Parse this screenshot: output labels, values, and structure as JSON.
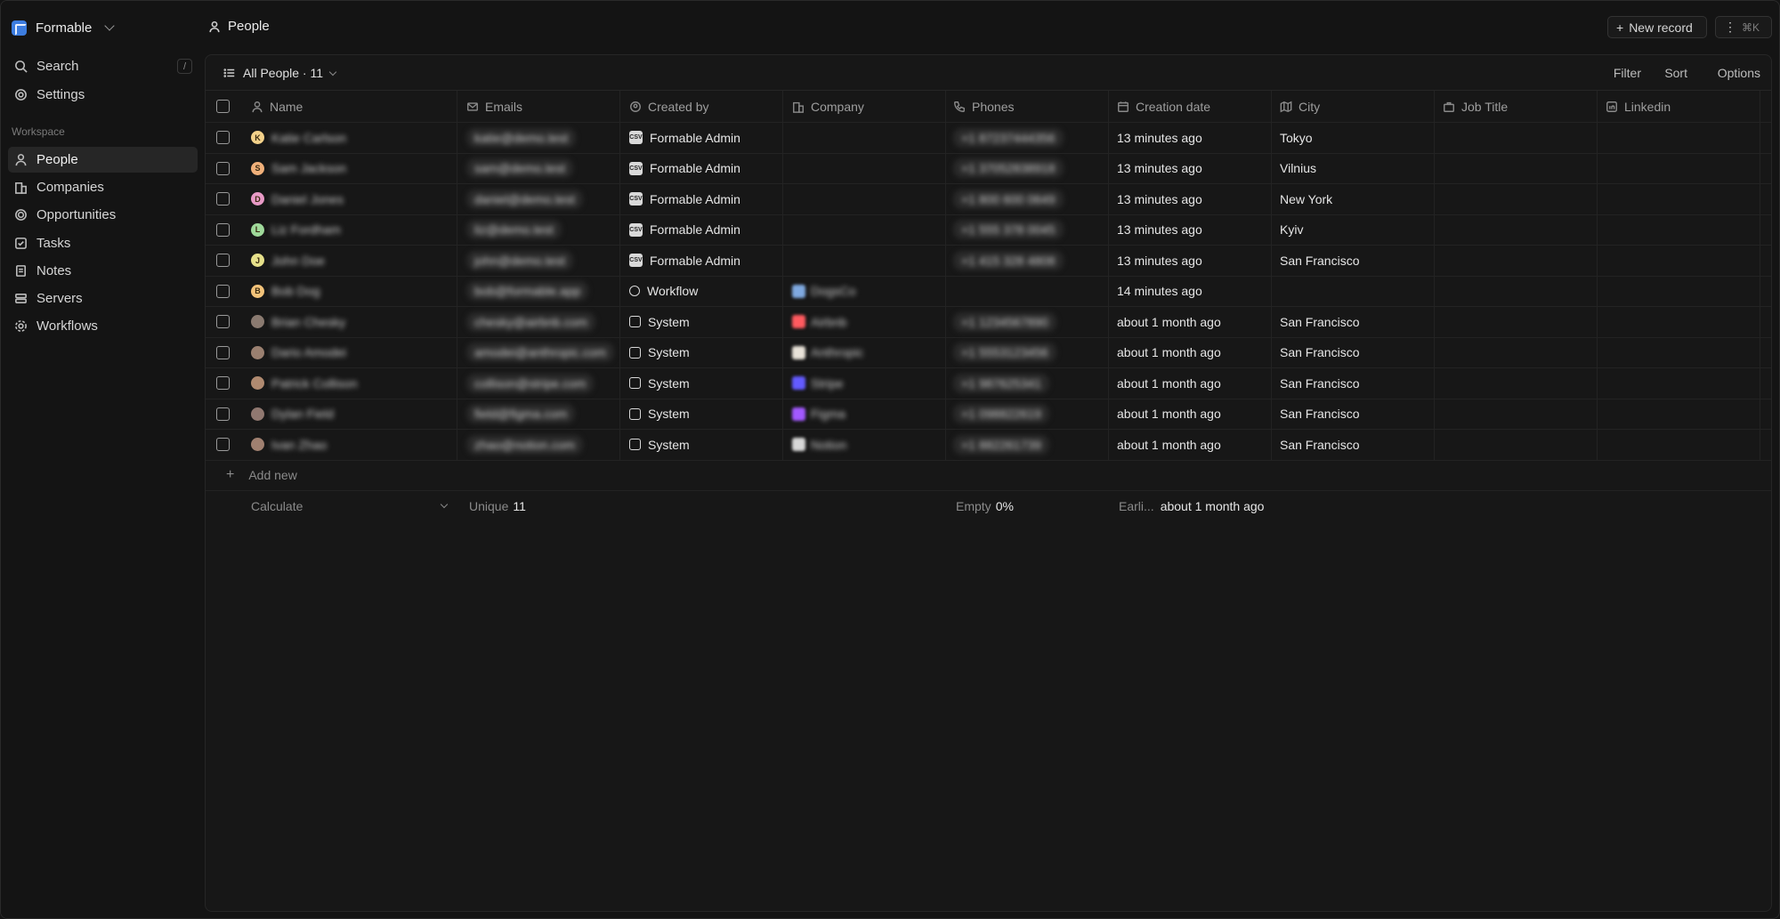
{
  "workspace": {
    "name": "Formable"
  },
  "sidebar": {
    "top_items": [
      {
        "label": "Search",
        "icon": "search-icon",
        "shortcut": "/"
      },
      {
        "label": "Settings",
        "icon": "gear-icon"
      }
    ],
    "section_label": "Workspace",
    "items": [
      {
        "label": "People",
        "icon": "person-icon",
        "active": true
      },
      {
        "label": "Companies",
        "icon": "building-icon"
      },
      {
        "label": "Opportunities",
        "icon": "target-icon"
      },
      {
        "label": "Tasks",
        "icon": "checkbox-icon"
      },
      {
        "label": "Notes",
        "icon": "note-icon"
      },
      {
        "label": "Servers",
        "icon": "server-icon"
      },
      {
        "label": "Workflows",
        "icon": "workflow-icon"
      }
    ]
  },
  "header": {
    "title": "People",
    "new_record_label": "New record",
    "more_shortcut": "⌘K"
  },
  "view": {
    "name": "All People · 11",
    "actions": {
      "filter": "Filter",
      "sort": "Sort",
      "options": "Options"
    }
  },
  "table": {
    "columns": [
      "Name",
      "Emails",
      "Created by",
      "Company",
      "Phones",
      "Creation date",
      "City",
      "Job Title",
      "Linkedin"
    ],
    "rows": [
      {
        "initial": "K",
        "avatar_color": "#f3d18a",
        "name": "Katie Carlson",
        "email": "katie@demo.test",
        "created_by": "Formable Admin",
        "creator_type": "csv",
        "company": "",
        "company_color": "",
        "phone": "+1 87237444356",
        "date": "13 minutes ago",
        "city": "Tokyo"
      },
      {
        "initial": "S",
        "avatar_color": "#f0b07a",
        "name": "Sam Jackson",
        "email": "sam@demo.test",
        "created_by": "Formable Admin",
        "creator_type": "csv",
        "company": "",
        "company_color": "",
        "phone": "+1 37052838918",
        "date": "13 minutes ago",
        "city": "Vilnius"
      },
      {
        "initial": "D",
        "avatar_color": "#e89ac6",
        "name": "Daniel Jones",
        "email": "daniel@demo.test",
        "created_by": "Formable Admin",
        "creator_type": "csv",
        "company": "",
        "company_color": "",
        "phone": "+1 800 600 0649",
        "date": "13 minutes ago",
        "city": "New York"
      },
      {
        "initial": "L",
        "avatar_color": "#9fd99a",
        "name": "Liz Fordham",
        "email": "liz@demo.test",
        "created_by": "Formable Admin",
        "creator_type": "csv",
        "company": "",
        "company_color": "",
        "phone": "+1 555 378 0045",
        "date": "13 minutes ago",
        "city": "Kyiv"
      },
      {
        "initial": "J",
        "avatar_color": "#e6e08a",
        "name": "John Doe",
        "email": "john@demo.test",
        "created_by": "Formable Admin",
        "creator_type": "csv",
        "company": "",
        "company_color": "",
        "phone": "+1 415 328 4808",
        "date": "13 minutes ago",
        "city": "San Francisco"
      },
      {
        "initial": "B",
        "avatar_color": "#f3c37a",
        "name": "Bob Dog",
        "email": "bob@formable.app",
        "created_by": "Workflow",
        "creator_type": "workflow",
        "company": "DogsCo",
        "company_color": "#7fa9e0",
        "phone": "",
        "date": "14 minutes ago",
        "city": ""
      },
      {
        "initial": "",
        "avatar_color": "#8a7a70",
        "name": "Brian Chesky",
        "email": "chesky@airbnb.com",
        "created_by": "System",
        "creator_type": "system",
        "company": "Airbnb",
        "company_color": "#ff5a5f",
        "phone": "+1 1234567890",
        "date": "about 1 month ago",
        "city": "San Francisco"
      },
      {
        "initial": "",
        "avatar_color": "#9a8070",
        "name": "Dario Amodei",
        "email": "amodei@anthropic.com",
        "created_by": "System",
        "creator_type": "system",
        "company": "Anthropic",
        "company_color": "#e8e2d8",
        "phone": "+1 5553123456",
        "date": "about 1 month ago",
        "city": "San Francisco"
      },
      {
        "initial": "",
        "avatar_color": "#b08a70",
        "name": "Patrick Collison",
        "email": "collison@stripe.com",
        "created_by": "System",
        "creator_type": "system",
        "company": "Stripe",
        "company_color": "#635bff",
        "phone": "+1 987625341",
        "date": "about 1 month ago",
        "city": "San Francisco"
      },
      {
        "initial": "",
        "avatar_color": "#907870",
        "name": "Dylan Field",
        "email": "field@figma.com",
        "created_by": "System",
        "creator_type": "system",
        "company": "Figma",
        "company_color": "#a259ff",
        "phone": "+1 098822619",
        "date": "about 1 month ago",
        "city": "San Francisco"
      },
      {
        "initial": "",
        "avatar_color": "#a08070",
        "name": "Ivan Zhao",
        "email": "zhao@notion.com",
        "created_by": "System",
        "creator_type": "system",
        "company": "Notion",
        "company_color": "#d8d8d8",
        "phone": "+1 882261739",
        "date": "about 1 month ago",
        "city": "San Francisco"
      }
    ],
    "add_new_label": "Add new",
    "footer": {
      "calculate_label": "Calculate",
      "emails_agg_label": "Unique",
      "emails_agg_value": "11",
      "phones_agg_label": "Empty",
      "phones_agg_value": "0%",
      "date_agg_label": "Earli...",
      "date_agg_value": "about 1 month ago"
    }
  }
}
